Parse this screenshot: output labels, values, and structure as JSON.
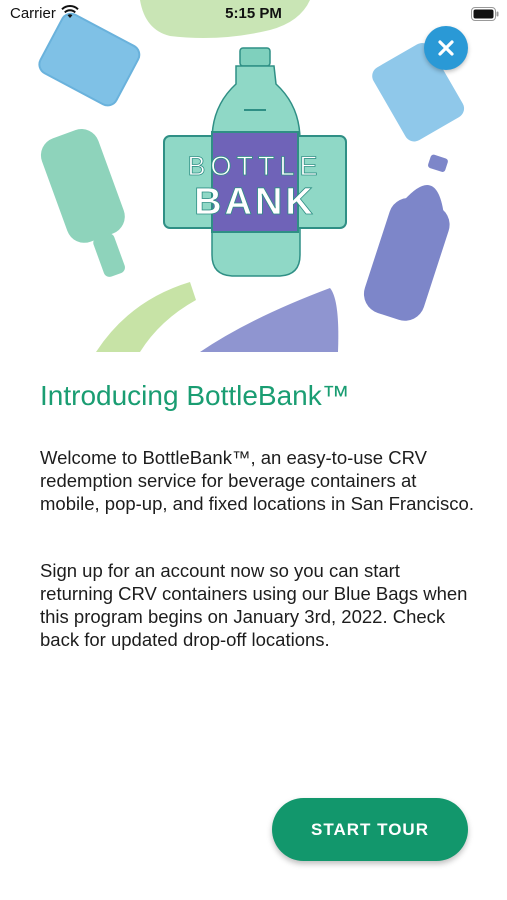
{
  "status_bar": {
    "carrier": "Carrier",
    "time": "5:15 PM"
  },
  "hero": {
    "logo_line1": "BOTTLE",
    "logo_line2": "BANK"
  },
  "intro": {
    "title": "Introducing BottleBank™",
    "paragraph1": "Welcome to BottleBank™, an easy-to-use CRV redemption service for beverage containers at mobile, pop-up, and fixed locations in San Francisco.",
    "paragraph2": "Sign up for an account now so you can start returning CRV containers using our Blue Bags when this program begins on January 3rd, 2022. Check back for updated drop-off locations."
  },
  "actions": {
    "start_tour_label": "START TOUR",
    "close_icon": "close-icon"
  },
  "colors": {
    "accent_green": "#12976c",
    "title_green": "#1a9d72",
    "close_blue": "#2a99d6"
  }
}
